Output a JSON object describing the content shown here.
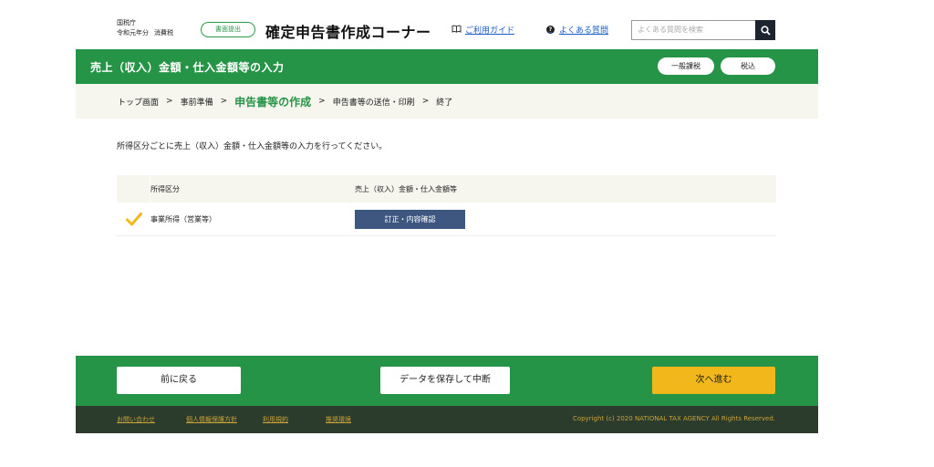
{
  "header": {
    "agency": "国税庁",
    "year_period": "令和元年分",
    "tax_type": "消費税",
    "paper_badge": "書面提出",
    "site_title": "確定申告書作成コーナー",
    "guide_link": "ご利用ガイド",
    "faq_link": "よくある質問",
    "search_placeholder": "よくある質問を検索"
  },
  "title_bar": {
    "title": "売上（収入）金額・仕入金額等の入力",
    "pill_general": "一般課税",
    "pill_tax_included": "税込"
  },
  "breadcrumb": {
    "items": [
      "トップ画面",
      "事前準備",
      "申告書等の作成",
      "申告書等の送信・印刷",
      "終了"
    ],
    "current_index": 2
  },
  "intro_text": "所得区分ごとに売上（収入）金額・仕入金額等の入力を行ってください。",
  "table": {
    "headers": [
      "所得区分",
      "売上（収入）金額・仕入金額等"
    ],
    "rows": [
      {
        "category": "事業所得（営業等）",
        "button": "訂正・内容確認",
        "checked": true
      }
    ]
  },
  "footer": {
    "back": "前に戻る",
    "save": "データを保存して中断",
    "next": "次へ進む",
    "links": [
      "お問い合わせ",
      "個人情報保護方針",
      "利用規約",
      "推奨環境"
    ],
    "copyright": "Copyright (c) 2020 NATIONAL TAX AGENCY All Rights Reserved."
  },
  "colors": {
    "brand_green": "#269447",
    "next_button": "#f2b81b",
    "edit_button": "#3d5781",
    "check": "#f2b81b"
  },
  "icons": [
    "book-icon",
    "question-icon",
    "search-icon",
    "check-icon"
  ]
}
